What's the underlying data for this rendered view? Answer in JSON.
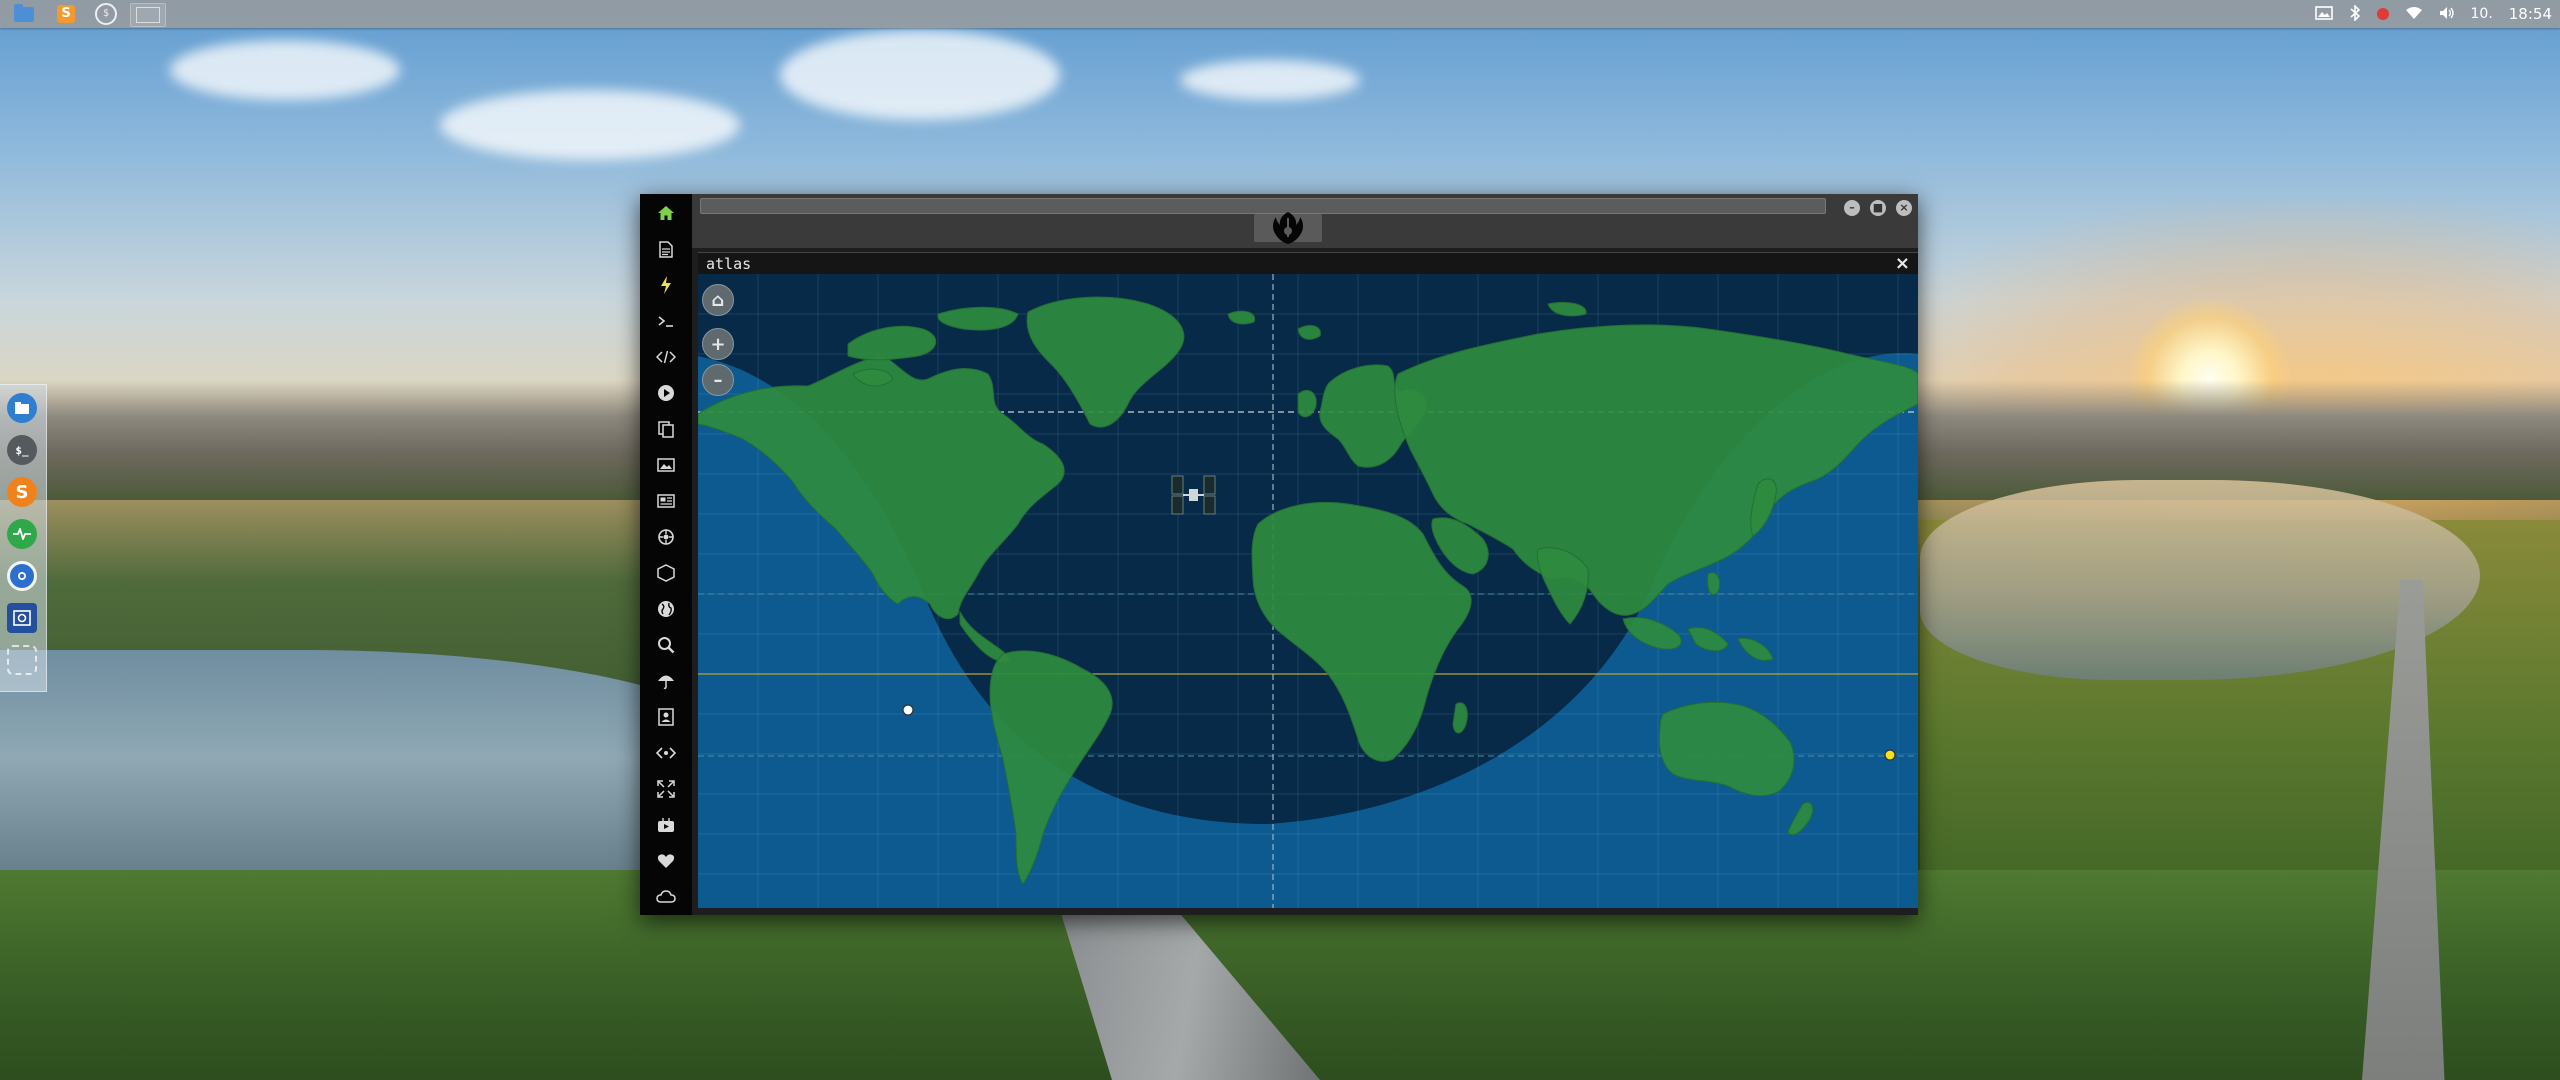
{
  "top_panel": {
    "launchers": [
      "folder-icon",
      "sublime-text-icon",
      "terminal-dollar-icon",
      "workspace-window-icon"
    ],
    "tray_icons": [
      "image-icon",
      "bluetooth-icon",
      "record-icon",
      "wifi-icon",
      "volume-icon"
    ],
    "volume": "10.",
    "clock": "18:54"
  },
  "dock": {
    "items": [
      "file-manager-icon",
      "terminal-icon",
      "sublime-text-icon",
      "system-monitor-icon",
      "chromium-icon",
      "screen-capture-icon",
      "workspace-icon"
    ]
  },
  "app": {
    "sidebar_icons": [
      "home-icon",
      "document-icon",
      "lightning-icon",
      "terminal-icon",
      "code-icon",
      "play-icon",
      "copy-icon",
      "image-icon",
      "news-icon",
      "settings-icon",
      "cube-icon",
      "globe-icon",
      "search-icon",
      "umbrella-icon",
      "contact-icon",
      "swap-icon",
      "expand-icon",
      "youtube-icon",
      "heart-icon",
      "cloud-icon"
    ],
    "emblem": "rebel-alliance-icon",
    "window_buttons": [
      "minimize",
      "maximize",
      "close"
    ],
    "window_button_glyphs": [
      "–",
      "■",
      "×"
    ],
    "tab_title": "atlas",
    "tab_close": "×",
    "map_controls": {
      "home": "⌂",
      "zoom_in": "+",
      "zoom_out": "–"
    },
    "colors": {
      "ocean_day": "#0c5a8f",
      "ocean_night": "#062a48",
      "land": "#2e8b3f",
      "accent_green": "#7fd14d",
      "moon_marker": "#ffffff",
      "sun_marker": "#f7e31a"
    },
    "satellite_icon": "iss-satellite-icon"
  }
}
